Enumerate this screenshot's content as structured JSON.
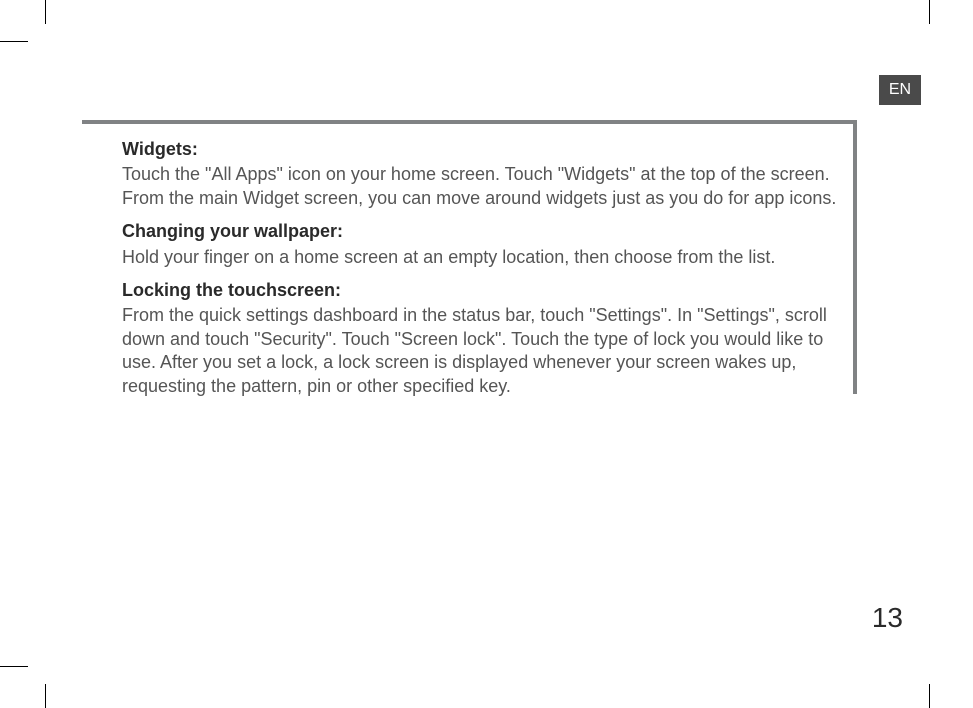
{
  "lang_tab": "EN",
  "page_number": "13",
  "sections": [
    {
      "heading": "Widgets:",
      "body": "Touch the \"All Apps\" icon on your home screen. Touch \"Widgets\" at the top of the screen. From the main Widget screen, you can move around widgets just as you do for app icons."
    },
    {
      "heading": "Changing your wallpaper:",
      "body": "Hold your finger on a home screen at an empty location, then choose from the list."
    },
    {
      "heading": "Locking the touchscreen:",
      "body": "From the quick settings dashboard in the status bar, touch \"Settings\". In \"Settings\", scroll down and touch \"Security\". Touch \"Screen lock\". Touch the type of lock you would like to use. After you set a lock, a lock screen is displayed whenever your screen wakes up, requesting the pattern, pin or other specified key."
    }
  ]
}
